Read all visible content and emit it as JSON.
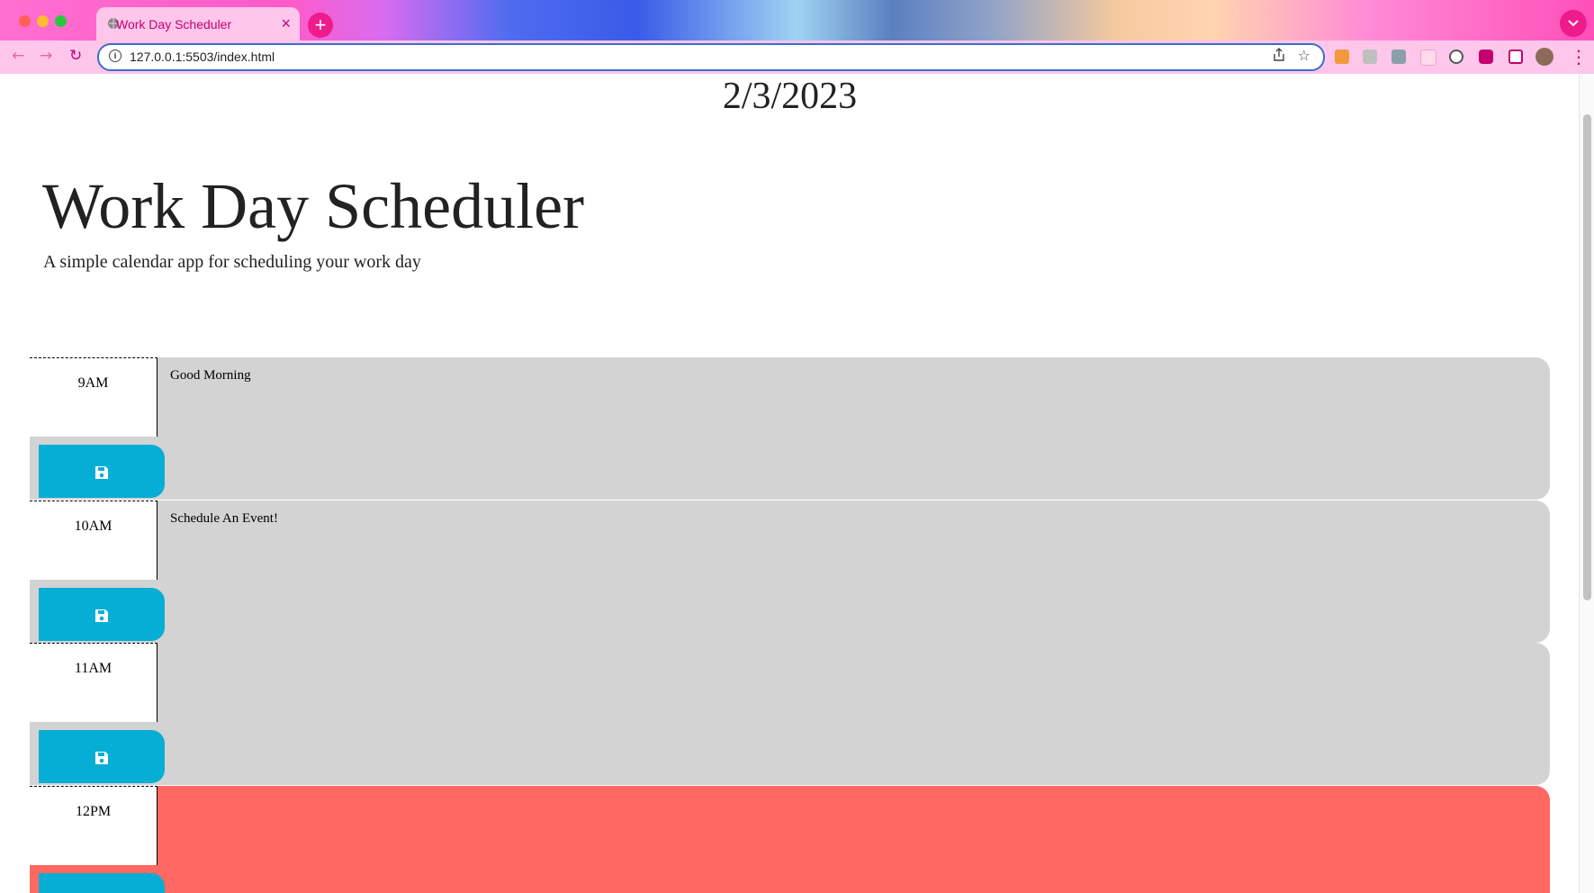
{
  "browser": {
    "tab_title": "Work Day Scheduler",
    "tab_close": "×",
    "new_tab": "+",
    "url": "127.0.0.1:5503/index.html"
  },
  "header": {
    "current_day": "2/3/2023",
    "title": "Work Day Scheduler",
    "lead": "A simple calendar app for scheduling your work day"
  },
  "timeblocks": [
    {
      "hour": "9AM",
      "text": "Good Morning",
      "state": "past"
    },
    {
      "hour": "10AM",
      "text": "Schedule An Event!",
      "state": "past"
    },
    {
      "hour": "11AM",
      "text": "",
      "state": "past"
    },
    {
      "hour": "12PM",
      "text": "",
      "state": "present"
    }
  ],
  "colors": {
    "past": "#d3d3d3",
    "present": "#ff6961",
    "save_button": "#06aed5"
  }
}
